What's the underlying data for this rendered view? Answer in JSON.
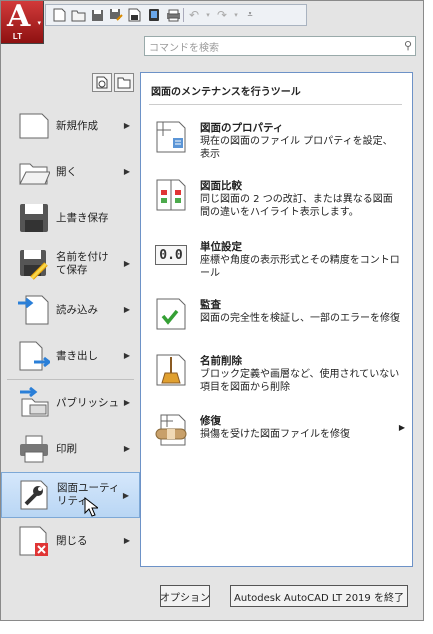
{
  "app_button": {
    "letter": "A",
    "badge": "LT"
  },
  "quick_access": {
    "icons": [
      "new-icon",
      "open-icon",
      "save-icon",
      "save-as-icon",
      "publish-icon",
      "share-icon",
      "plot-icon",
      "undo-icon",
      "redo-icon",
      "customize-icon"
    ]
  },
  "search": {
    "placeholder": "コマンドを検索"
  },
  "menu": {
    "items": [
      {
        "label": "新規作成",
        "arrow": "▶"
      },
      {
        "label": "開く",
        "arrow": "▶"
      },
      {
        "label": "上書き保存"
      },
      {
        "label": "名前を付け\nて保存",
        "arrow": "▶"
      },
      {
        "label": "読み込み",
        "arrow": "▶"
      },
      {
        "label": "書き出し",
        "arrow": "▶"
      },
      {
        "label": "パブリッシュ",
        "arrow": "▶"
      },
      {
        "label": "印刷",
        "arrow": "▶"
      },
      {
        "label": "図面ユーティ\nリティ",
        "arrow": "▶"
      },
      {
        "label": "閉じる",
        "arrow": "▶"
      }
    ]
  },
  "panel": {
    "title": "図面のメンテナンスを行うツール",
    "items": [
      {
        "title": "図面のプロパティ",
        "desc": "現在の図面のファイル プロパティを設定、表示"
      },
      {
        "title": "図面比較",
        "desc": "同じ図面の 2 つの改訂、または異なる図面間の違いをハイライト表示します。"
      },
      {
        "title": "単位設定",
        "desc": "座標や角度の表示形式とその精度をコントロール",
        "icon_text": "0.0"
      },
      {
        "title": "監査",
        "desc": "図面の完全性を検証し、一部のエラーを修復"
      },
      {
        "title": "名前削除",
        "desc": "ブロック定義や画層など、使用されていない項目を図面から削除"
      },
      {
        "title": "修復",
        "desc": "損傷を受けた図面ファイルを修復",
        "arrow": "▶"
      }
    ]
  },
  "footer": {
    "options_label": "オプション",
    "exit_label": "Autodesk AutoCAD LT 2019 を終了"
  }
}
